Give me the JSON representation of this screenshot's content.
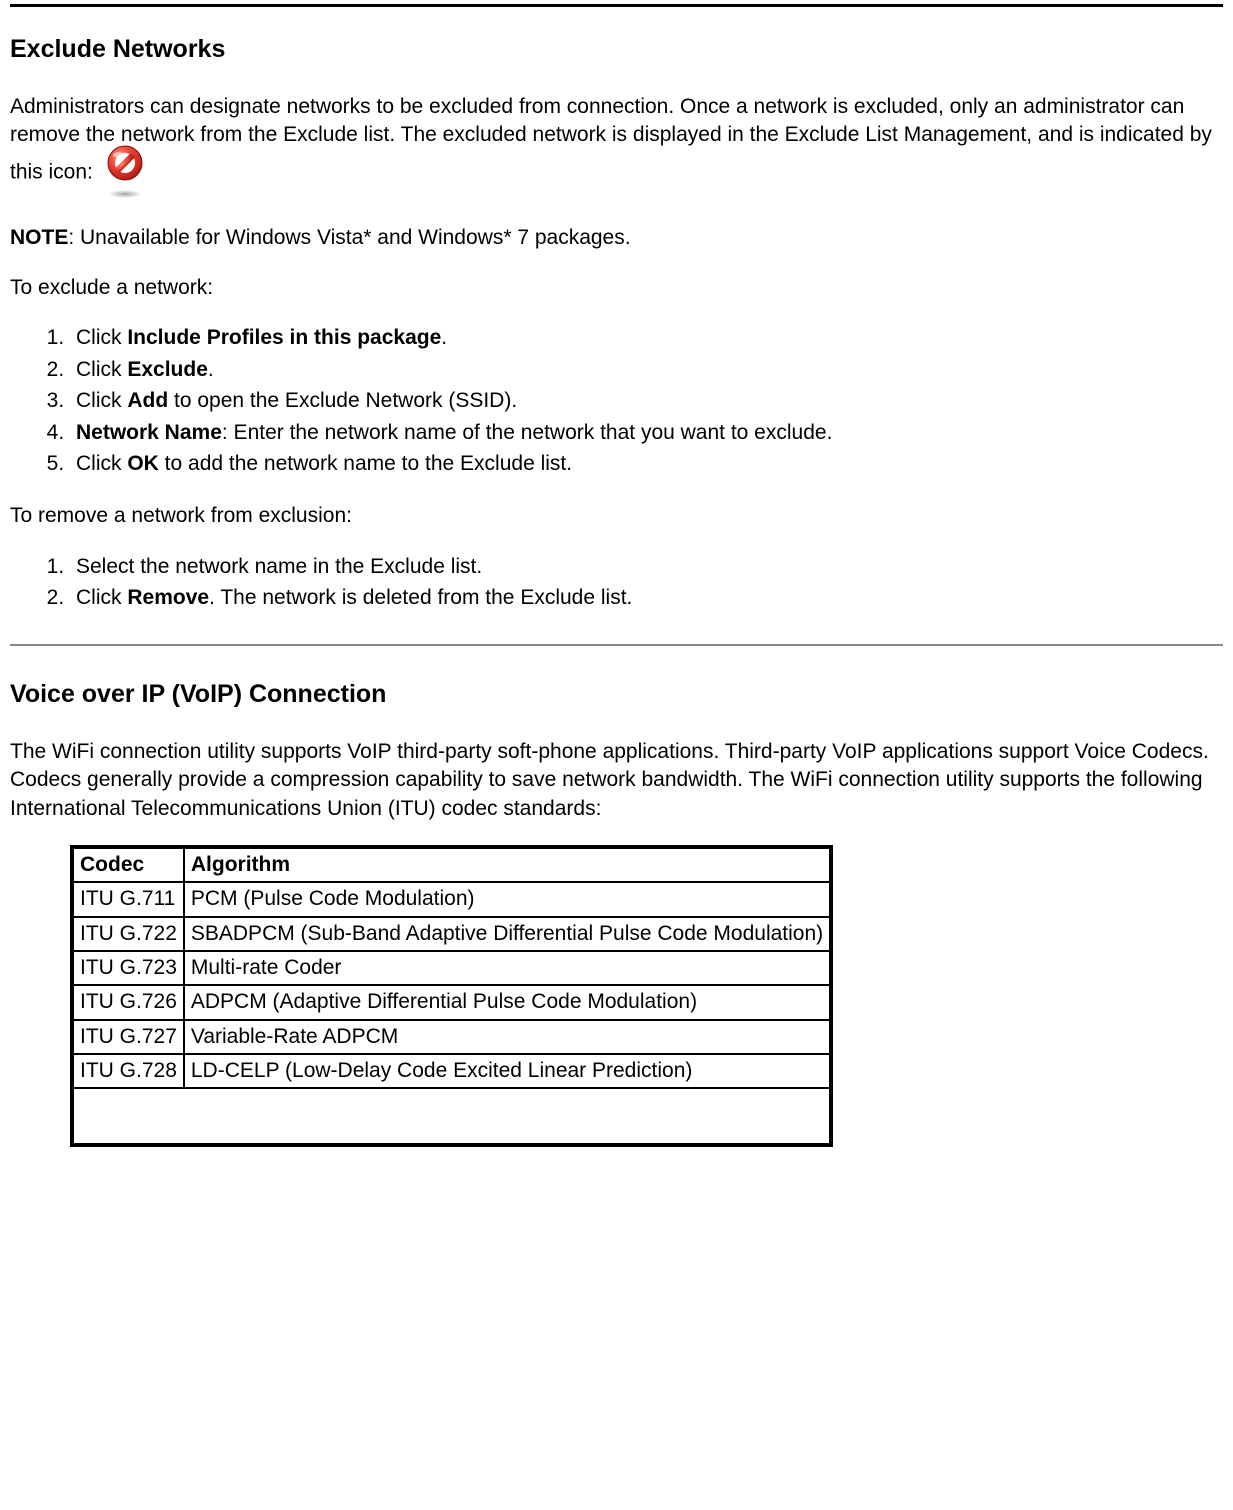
{
  "section1": {
    "heading": "Exclude Networks",
    "intro_before_icon": "Administrators can designate networks to be excluded from connection. Once a network is excluded, only an administrator can remove the network from the Exclude list. The excluded network is displayed in the Exclude List Management, and is indicated by this icon:",
    "note_label": "NOTE",
    "note_text": ": Unavailable for Windows Vista* and Windows* 7 packages.",
    "to_exclude_intro": "To exclude a network:",
    "exclude_steps": [
      {
        "prefix": "Click ",
        "bold": "Include Profiles in this package",
        "suffix": "."
      },
      {
        "prefix": "Click ",
        "bold": "Exclude",
        "suffix": "."
      },
      {
        "prefix": "Click ",
        "bold": "Add",
        "suffix": " to open the Exclude Network (SSID)."
      },
      {
        "bold_first": "Network Name",
        "suffix": ": Enter the network name of the network that you want to exclude."
      },
      {
        "prefix": "Click ",
        "bold": "OK",
        "suffix": " to add the network name to the Exclude list."
      }
    ],
    "to_remove_intro": "To remove a network from exclusion:",
    "remove_steps": [
      {
        "text": "Select the network name in the Exclude list."
      },
      {
        "prefix": "Click ",
        "bold": "Remove",
        "suffix": ". The network is deleted from the Exclude list."
      }
    ]
  },
  "section2": {
    "heading": "Voice over IP (VoIP) Connection",
    "intro": "The WiFi connection utility supports VoIP third-party soft-phone applications. Third-party VoIP applications support Voice Codecs. Codecs generally provide a compression capability to save network bandwidth. The WiFi connection utility supports the following International Telecommunications Union (ITU) codec standards:",
    "table": {
      "headers": [
        "Codec",
        "Algorithm"
      ],
      "rows": [
        [
          "ITU G.711",
          "PCM (Pulse Code Modulation)"
        ],
        [
          "ITU G.722",
          "SBADPCM (Sub-Band Adaptive Differential Pulse Code Modulation)"
        ],
        [
          "ITU G.723",
          "Multi-rate Coder"
        ],
        [
          "ITU G.726",
          "ADPCM (Adaptive Differential Pulse Code Modulation)"
        ],
        [
          "ITU G.727",
          "Variable-Rate ADPCM"
        ],
        [
          "ITU G.728",
          "LD-CELP (Low-Delay Code Excited Linear Prediction)"
        ]
      ]
    }
  }
}
